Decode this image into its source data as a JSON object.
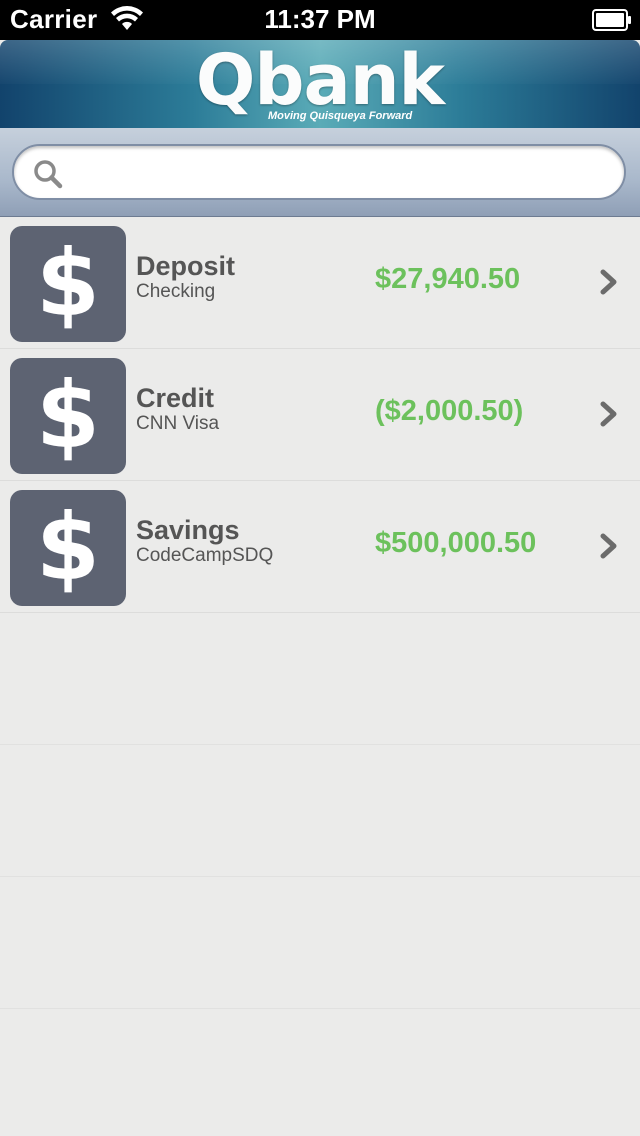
{
  "status_bar": {
    "carrier": "Carrier",
    "time": "11:37 PM"
  },
  "header": {
    "logo": "Qbank",
    "tagline": "Moving Quisqueya Forward"
  },
  "search": {
    "placeholder": "",
    "icon": "search-icon"
  },
  "accounts": [
    {
      "name": "Deposit",
      "sub": "Checking",
      "amount": "$27,940.50"
    },
    {
      "name": "Credit",
      "sub": "CNN Visa",
      "amount": "($2,000.50)"
    },
    {
      "name": "Savings",
      "sub": "CodeCampSDQ",
      "amount": "$500,000.50"
    }
  ],
  "colors": {
    "amount": "#6cc15c",
    "icon_tile": "#5d6372",
    "text": "#555555"
  }
}
